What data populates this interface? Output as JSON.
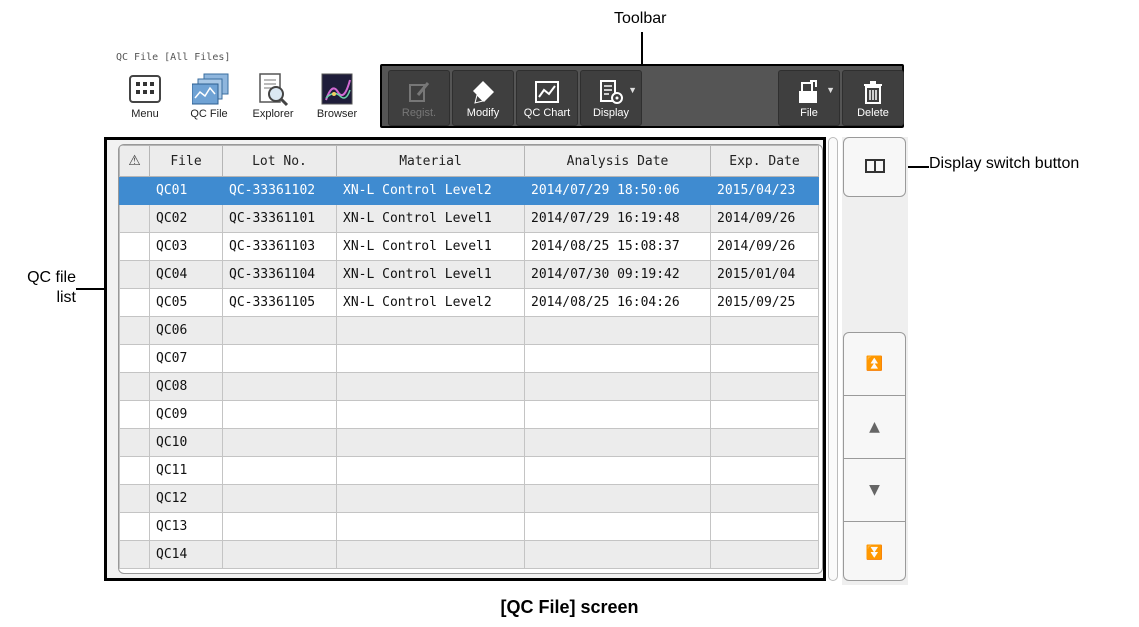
{
  "callouts": {
    "toolbar": "Toolbar",
    "display_switch": "Display switch button",
    "qc_file_list_line1": "QC file",
    "qc_file_list_line2": "list"
  },
  "screen": {
    "title": "QC File [All Files]"
  },
  "app_buttons": [
    {
      "label": "Menu",
      "icon": "grid-menu-icon"
    },
    {
      "label": "QC File",
      "icon": "qc-file-icon"
    },
    {
      "label": "Explorer",
      "icon": "explorer-icon"
    },
    {
      "label": "Browser",
      "icon": "browser-icon"
    }
  ],
  "toolbar": {
    "regist": "Regist.",
    "modify": "Modify",
    "qc_chart": "QC Chart",
    "display": "Display",
    "file": "File",
    "delete": "Delete"
  },
  "table": {
    "headers": {
      "flag": "⚠",
      "file": "File",
      "lot": "Lot No.",
      "material": "Material",
      "analysis_date": "Analysis Date",
      "exp_date": "Exp. Date"
    },
    "rows": [
      {
        "file": "QC01",
        "lot": "QC-33361102",
        "material": "XN-L Control Level2",
        "analysis_date": "2014/07/29 18:50:06",
        "exp_date": "2015/04/23"
      },
      {
        "file": "QC02",
        "lot": "QC-33361101",
        "material": "XN-L Control Level1",
        "analysis_date": "2014/07/29 16:19:48",
        "exp_date": "2014/09/26"
      },
      {
        "file": "QC03",
        "lot": "QC-33361103",
        "material": "XN-L Control Level1",
        "analysis_date": "2014/08/25 15:08:37",
        "exp_date": "2014/09/26"
      },
      {
        "file": "QC04",
        "lot": "QC-33361104",
        "material": "XN-L Control Level1",
        "analysis_date": "2014/07/30 09:19:42",
        "exp_date": "2015/01/04"
      },
      {
        "file": "QC05",
        "lot": "QC-33361105",
        "material": "XN-L Control Level2",
        "analysis_date": "2014/08/25 16:04:26",
        "exp_date": "2015/09/25"
      },
      {
        "file": "QC06",
        "lot": "",
        "material": "",
        "analysis_date": "",
        "exp_date": ""
      },
      {
        "file": "QC07",
        "lot": "",
        "material": "",
        "analysis_date": "",
        "exp_date": ""
      },
      {
        "file": "QC08",
        "lot": "",
        "material": "",
        "analysis_date": "",
        "exp_date": ""
      },
      {
        "file": "QC09",
        "lot": "",
        "material": "",
        "analysis_date": "",
        "exp_date": ""
      },
      {
        "file": "QC10",
        "lot": "",
        "material": "",
        "analysis_date": "",
        "exp_date": ""
      },
      {
        "file": "QC11",
        "lot": "",
        "material": "",
        "analysis_date": "",
        "exp_date": ""
      },
      {
        "file": "QC12",
        "lot": "",
        "material": "",
        "analysis_date": "",
        "exp_date": ""
      },
      {
        "file": "QC13",
        "lot": "",
        "material": "",
        "analysis_date": "",
        "exp_date": ""
      },
      {
        "file": "QC14",
        "lot": "",
        "material": "",
        "analysis_date": "",
        "exp_date": ""
      }
    ]
  },
  "scroll_buttons": [
    "scroll-top-icon",
    "scroll-up-icon",
    "scroll-down-icon",
    "scroll-bottom-icon"
  ],
  "caption": "[QC File] screen",
  "colors": {
    "selected_row": "#3f8bd0",
    "toolbar_bg": "#555555"
  }
}
